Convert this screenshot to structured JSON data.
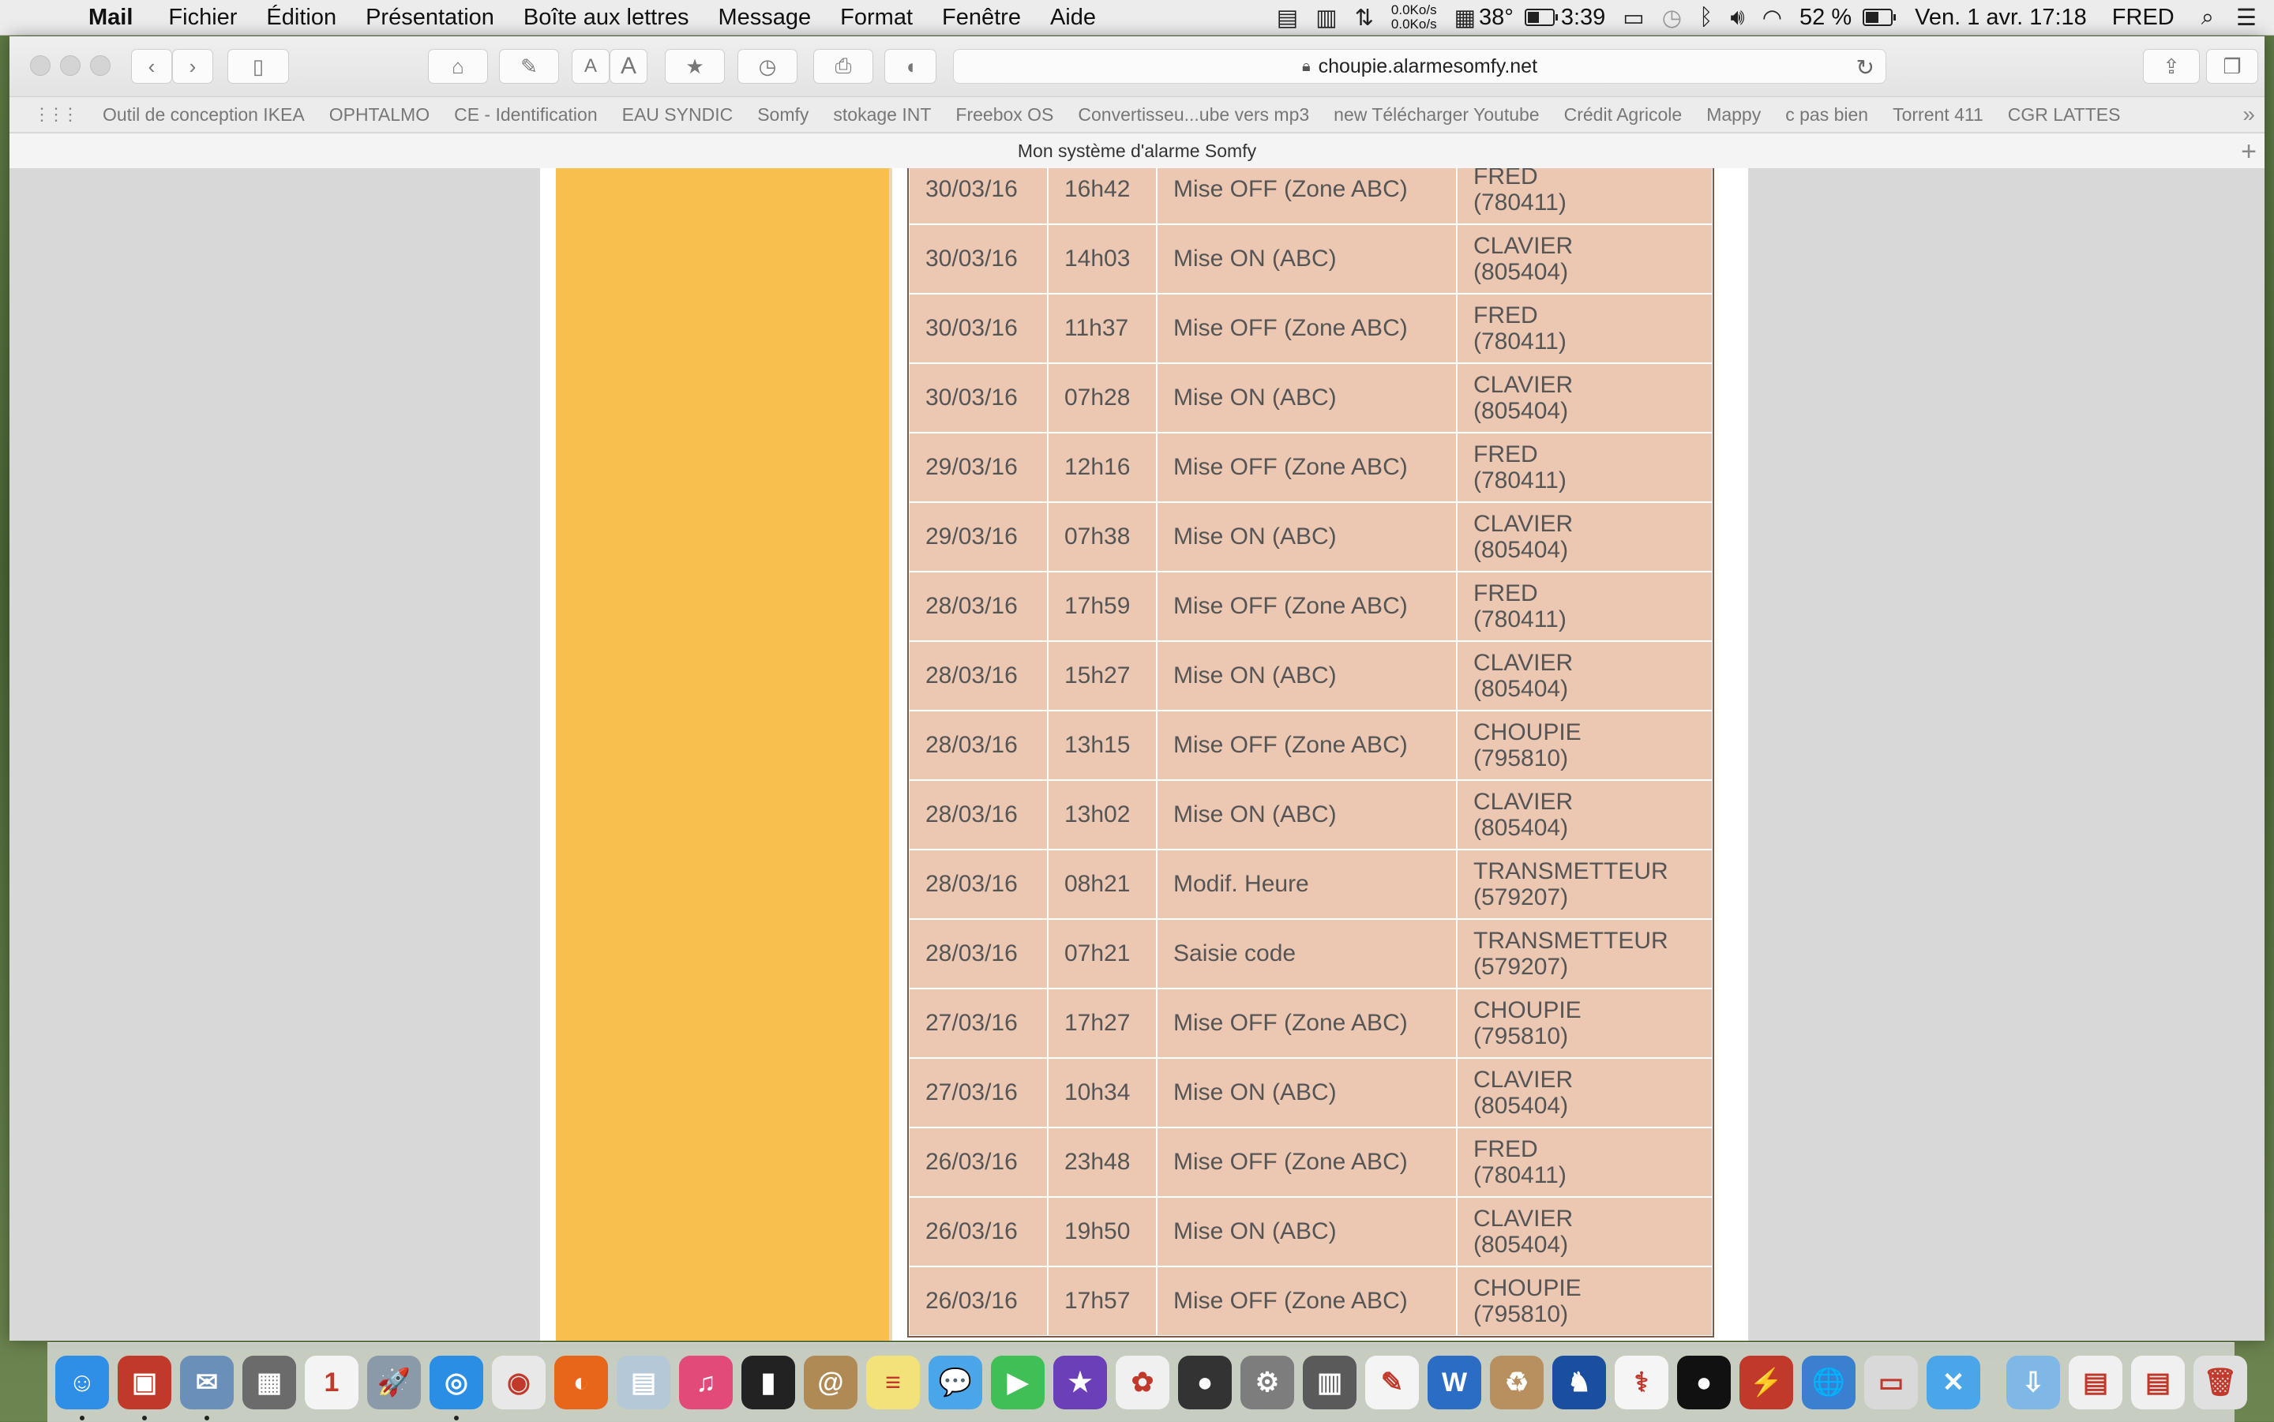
{
  "menubar": {
    "app": "Mail",
    "items": [
      "Fichier",
      "Édition",
      "Présentation",
      "Boîte aux lettres",
      "Message",
      "Format",
      "Fenêtre",
      "Aide"
    ],
    "net_up": "0.0Ko/s",
    "net_down": "0.0Ko/s",
    "temperature": "38°",
    "battery_time": "3:39",
    "battery_percent": "52 %",
    "battery_level": 0.52,
    "datetime": "Ven. 1 avr.  17:18",
    "user": "FRED"
  },
  "browser": {
    "url": "choupie.alarmesomfy.net",
    "tab_title": "Mon système d'alarme Somfy",
    "bookmarks": [
      "Outil de conception IKEA",
      "OPHTALMO",
      "CE - Identification",
      "EAU SYNDIC",
      "Somfy",
      "stokage INT",
      "Freebox OS",
      "Convertisseu...ube vers mp3",
      "new Télécharger Youtube",
      "Crédit Agricole",
      "Mappy",
      "c pas bien",
      "Torrent 411",
      "CGR LATTES"
    ]
  },
  "log": {
    "rows": [
      {
        "date": "30/03/16",
        "time": "16h42",
        "event": "Mise OFF (Zone ABC)",
        "user": "FRED",
        "code": "(780411)"
      },
      {
        "date": "30/03/16",
        "time": "14h03",
        "event": "Mise ON (ABC)",
        "user": "CLAVIER",
        "code": "(805404)"
      },
      {
        "date": "30/03/16",
        "time": "11h37",
        "event": "Mise OFF (Zone ABC)",
        "user": "FRED",
        "code": "(780411)"
      },
      {
        "date": "30/03/16",
        "time": "07h28",
        "event": "Mise ON (ABC)",
        "user": "CLAVIER",
        "code": "(805404)"
      },
      {
        "date": "29/03/16",
        "time": "12h16",
        "event": "Mise OFF (Zone ABC)",
        "user": "FRED",
        "code": "(780411)"
      },
      {
        "date": "29/03/16",
        "time": "07h38",
        "event": "Mise ON (ABC)",
        "user": "CLAVIER",
        "code": "(805404)"
      },
      {
        "date": "28/03/16",
        "time": "17h59",
        "event": "Mise OFF (Zone ABC)",
        "user": "FRED",
        "code": "(780411)"
      },
      {
        "date": "28/03/16",
        "time": "15h27",
        "event": "Mise ON (ABC)",
        "user": "CLAVIER",
        "code": "(805404)"
      },
      {
        "date": "28/03/16",
        "time": "13h15",
        "event": "Mise OFF (Zone ABC)",
        "user": "CHOUPIE",
        "code": "(795810)"
      },
      {
        "date": "28/03/16",
        "time": "13h02",
        "event": "Mise ON (ABC)",
        "user": "CLAVIER",
        "code": "(805404)"
      },
      {
        "date": "28/03/16",
        "time": "08h21",
        "event": "Modif. Heure",
        "user": "TRANSMETTEUR",
        "code": "(579207)"
      },
      {
        "date": "28/03/16",
        "time": "07h21",
        "event": "Saisie code",
        "user": "TRANSMETTEUR",
        "code": "(579207)"
      },
      {
        "date": "27/03/16",
        "time": "17h27",
        "event": "Mise OFF (Zone ABC)",
        "user": "CHOUPIE",
        "code": "(795810)"
      },
      {
        "date": "27/03/16",
        "time": "10h34",
        "event": "Mise ON (ABC)",
        "user": "CLAVIER",
        "code": "(805404)"
      },
      {
        "date": "26/03/16",
        "time": "23h48",
        "event": "Mise OFF (Zone ABC)",
        "user": "FRED",
        "code": "(780411)"
      },
      {
        "date": "26/03/16",
        "time": "19h50",
        "event": "Mise ON (ABC)",
        "user": "CLAVIER",
        "code": "(805404)"
      },
      {
        "date": "26/03/16",
        "time": "17h57",
        "event": "Mise OFF (Zone ABC)",
        "user": "CHOUPIE",
        "code": "(795810)"
      }
    ]
  },
  "colors": {
    "sidebar_orange": "#f8bf4e",
    "table_bg": "#ecc8b3",
    "table_border": "#7d5a4a"
  },
  "dock": {
    "icons": [
      {
        "name": "finder-icon",
        "bg": "#2f8ee6",
        "glyph": "☺",
        "running": true
      },
      {
        "name": "photo-booth-icon",
        "bg": "#c0392b",
        "glyph": "▣",
        "running": true
      },
      {
        "name": "mail-icon",
        "bg": "#6a8fb8",
        "glyph": "✉",
        "running": true
      },
      {
        "name": "calculator-icon",
        "bg": "#6b6b6b",
        "glyph": "▦",
        "running": false
      },
      {
        "name": "calendar-icon",
        "bg": "#f4f4f4",
        "glyph": "1",
        "running": false
      },
      {
        "name": "launchpad-icon",
        "bg": "#8a9aa8",
        "glyph": "🚀",
        "running": false
      },
      {
        "name": "safari-icon",
        "bg": "#2a8ee4",
        "glyph": "◎",
        "running": true
      },
      {
        "name": "chrome-icon",
        "bg": "#e8e8e8",
        "glyph": "◉",
        "running": false
      },
      {
        "name": "firefox-icon",
        "bg": "#e8661a",
        "glyph": "◐",
        "running": false
      },
      {
        "name": "preview-icon",
        "bg": "#b5c8d8",
        "glyph": "▤",
        "running": false
      },
      {
        "name": "itunes-icon",
        "bg": "#e24a79",
        "glyph": "♫",
        "running": false
      },
      {
        "name": "deezer-icon",
        "bg": "#222222",
        "glyph": "▮",
        "running": false
      },
      {
        "name": "contacts-icon",
        "bg": "#b08a55",
        "glyph": "@",
        "running": false
      },
      {
        "name": "notes-icon",
        "bg": "#f3e27a",
        "glyph": "≡",
        "running": false
      },
      {
        "name": "messages-icon",
        "bg": "#4aa6e8",
        "glyph": "💬",
        "running": false
      },
      {
        "name": "facetime-icon",
        "bg": "#3fbf55",
        "glyph": "▶",
        "running": false
      },
      {
        "name": "imovie-icon",
        "bg": "#6a3fb8",
        "glyph": "★",
        "running": false
      },
      {
        "name": "photos-icon",
        "bg": "#f0f0f0",
        "glyph": "✿",
        "running": false
      },
      {
        "name": "camera-icon",
        "bg": "#333333",
        "glyph": "●",
        "running": false
      },
      {
        "name": "system-preferences-icon",
        "bg": "#7d7d7d",
        "glyph": "⚙",
        "running": false
      },
      {
        "name": "scanner-icon",
        "bg": "#5a5a5a",
        "glyph": "▥",
        "running": false
      },
      {
        "name": "textedit-icon",
        "bg": "#f4f4f4",
        "glyph": "✎",
        "running": false
      },
      {
        "name": "word-icon",
        "bg": "#2b6cc4",
        "glyph": "W",
        "running": false
      },
      {
        "name": "archive-icon",
        "bg": "#b89060",
        "glyph": "♻",
        "running": false
      },
      {
        "name": "app-icon-blue",
        "bg": "#1a4fa0",
        "glyph": "♞",
        "running": false
      },
      {
        "name": "app-icon-pink",
        "bg": "#f5f5f5",
        "glyph": "⚕",
        "running": false
      },
      {
        "name": "disc-icon",
        "bg": "#111111",
        "glyph": "●",
        "running": false
      },
      {
        "name": "filezilla-icon",
        "bg": "#c0392b",
        "glyph": "⚡",
        "running": false
      },
      {
        "name": "globe-icon",
        "bg": "#3b7fd0",
        "glyph": "🌐",
        "running": false
      },
      {
        "name": "screen-icon",
        "bg": "#d9d9d9",
        "glyph": "▭",
        "running": false
      },
      {
        "name": "x-app-icon",
        "bg": "#4aa6e8",
        "glyph": "✕",
        "running": false
      }
    ],
    "right_icons": [
      {
        "name": "downloads-folder-icon",
        "bg": "#7fb8e6",
        "glyph": "⇩"
      },
      {
        "name": "document-stack-icon",
        "bg": "#f0f0f0",
        "glyph": "▤"
      },
      {
        "name": "document-stack-2-icon",
        "bg": "#f0f0f0",
        "glyph": "▤"
      },
      {
        "name": "trash-icon",
        "bg": "#e0e0e0",
        "glyph": "🗑"
      }
    ]
  }
}
